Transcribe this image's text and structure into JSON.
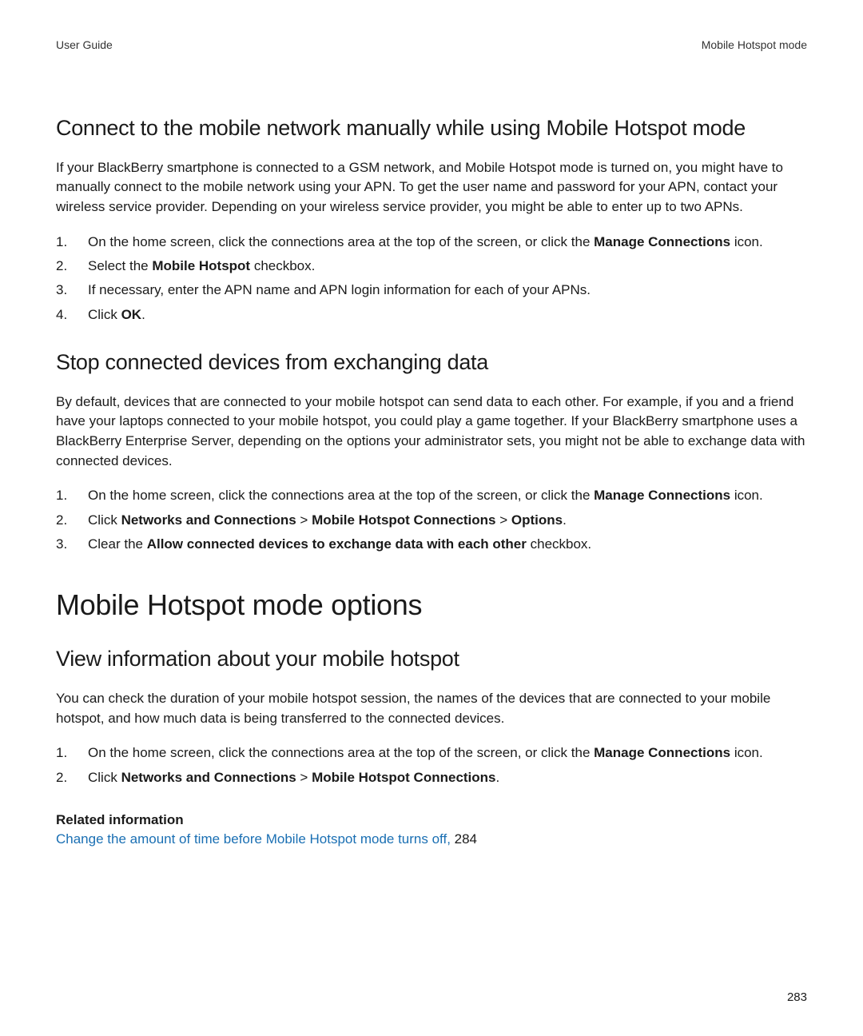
{
  "header": {
    "left": "User Guide",
    "right": "Mobile Hotspot mode"
  },
  "section1": {
    "heading": "Connect to the mobile network manually while using Mobile Hotspot mode",
    "intro": "If your BlackBerry smartphone is connected to a GSM network, and Mobile Hotspot mode is turned on, you might have to manually connect to the mobile network using your APN. To get the user name and password for your APN, contact your wireless service provider. Depending on your wireless service provider, you might be able to enter up to two APNs.",
    "steps": [
      {
        "pre": "On the home screen, click the connections area at the top of the screen, or click the ",
        "b1": "Manage Connections",
        "post": " icon."
      },
      {
        "pre": "Select the ",
        "b1": "Mobile Hotspot",
        "post": " checkbox."
      },
      {
        "pre": "If necessary, enter the APN name and APN login information for each of your APNs."
      },
      {
        "pre": "Click ",
        "b1": "OK",
        "post": "."
      }
    ]
  },
  "section2": {
    "heading": "Stop connected devices from exchanging data",
    "intro": "By default, devices that are connected to your mobile hotspot can send data to each other. For example, if you and a friend have your laptops connected to your mobile hotspot, you could play a game together. If your BlackBerry smartphone uses a BlackBerry Enterprise Server, depending on the options your administrator sets, you might not be able to exchange data with connected devices.",
    "steps": [
      {
        "pre": "On the home screen, click the connections area at the top of the screen, or click the ",
        "b1": "Manage Connections",
        "post": " icon."
      },
      {
        "pre": "Click ",
        "b1": "Networks and Connections",
        "mid1": " > ",
        "b2": "Mobile Hotspot Connections",
        "mid2": " > ",
        "b3": "Options",
        "post": "."
      },
      {
        "pre": "Clear the ",
        "b1": "Allow connected devices to exchange data with each other",
        "post": " checkbox."
      }
    ]
  },
  "main_heading": "Mobile Hotspot mode options",
  "section3": {
    "heading": "View information about your mobile hotspot",
    "intro": "You can check the duration of your mobile hotspot session, the names of the devices that are connected to your mobile hotspot, and how much data is being transferred to the connected devices.",
    "steps": [
      {
        "pre": "On the home screen, click the connections area at the top of the screen, or click the ",
        "b1": "Manage Connections",
        "post": " icon."
      },
      {
        "pre": "Click ",
        "b1": "Networks and Connections",
        "mid1": " > ",
        "b2": "Mobile Hotspot Connections",
        "post": "."
      }
    ]
  },
  "related": {
    "label": "Related information",
    "link_text": "Change the amount of time before Mobile Hotspot mode turns off, ",
    "page_ref": "284"
  },
  "page_number": "283"
}
